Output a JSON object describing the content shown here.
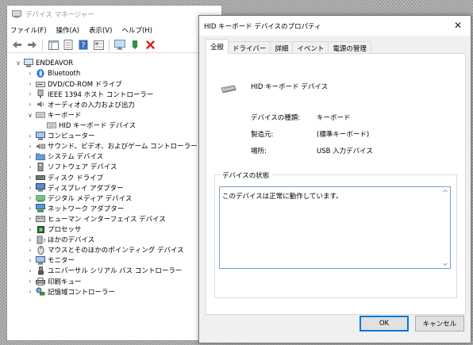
{
  "device_manager": {
    "title": "デバイス マネージャー",
    "menu": [
      "ファイル(F)",
      "操作(A)",
      "表示(V)",
      "ヘルプ(H)"
    ],
    "root": "ENDEAVOR",
    "categories": [
      {
        "label": "Bluetooth",
        "expanded": false
      },
      {
        "label": "DVD/CD-ROM ドライブ",
        "expanded": false
      },
      {
        "label": "IEEE 1394 ホスト コントローラー",
        "expanded": false
      },
      {
        "label": "オーディオの入力および出力",
        "expanded": false
      },
      {
        "label": "キーボード",
        "expanded": true
      },
      {
        "label": "コンピューター",
        "expanded": false
      },
      {
        "label": "サウンド、ビデオ、およびゲーム コントローラー",
        "expanded": false
      },
      {
        "label": "システム デバイス",
        "expanded": false
      },
      {
        "label": "ソフトウェア デバイス",
        "expanded": false
      },
      {
        "label": "ディスク ドライブ",
        "expanded": false
      },
      {
        "label": "ディスプレイ アダプター",
        "expanded": false
      },
      {
        "label": "デジタル メディア デバイス",
        "expanded": false
      },
      {
        "label": "ネットワーク アダプター",
        "expanded": false
      },
      {
        "label": "ヒューマン インターフェイス デバイス",
        "expanded": false
      },
      {
        "label": "プロセッサ",
        "expanded": false
      },
      {
        "label": "ほかのデバイス",
        "expanded": false
      },
      {
        "label": "マウスとそのほかのポインティング デバイス",
        "expanded": false
      },
      {
        "label": "モニター",
        "expanded": false
      },
      {
        "label": "ユニバーサル シリアル バス コントローラー",
        "expanded": false
      },
      {
        "label": "印刷キュー",
        "expanded": false
      },
      {
        "label": "記憶域コントローラー",
        "expanded": false
      }
    ],
    "keyboard_child": "HID キーボード デバイス"
  },
  "properties": {
    "title": "HID キーボード デバイスのプロパティ",
    "tabs": [
      "全般",
      "ドライバー",
      "詳細",
      "イベント",
      "電源の管理"
    ],
    "active_tab": "全般",
    "device_name": "HID キーボード デバイス",
    "rows": [
      {
        "label": "デバイスの種類:",
        "value": "キーボード"
      },
      {
        "label": "製造元:",
        "value": "(標準キーボード)"
      },
      {
        "label": "場所:",
        "value": "USB 入力デバイス"
      }
    ],
    "status_group_label": "デバイスの状態",
    "status_text": "このデバイスは正常に動作しています。",
    "ok_label": "OK",
    "cancel_label": "キャンセル"
  },
  "colors": {
    "accent": "#0078d7",
    "bluetooth": "#1a6fd6",
    "delete_red": "#d0231b"
  }
}
